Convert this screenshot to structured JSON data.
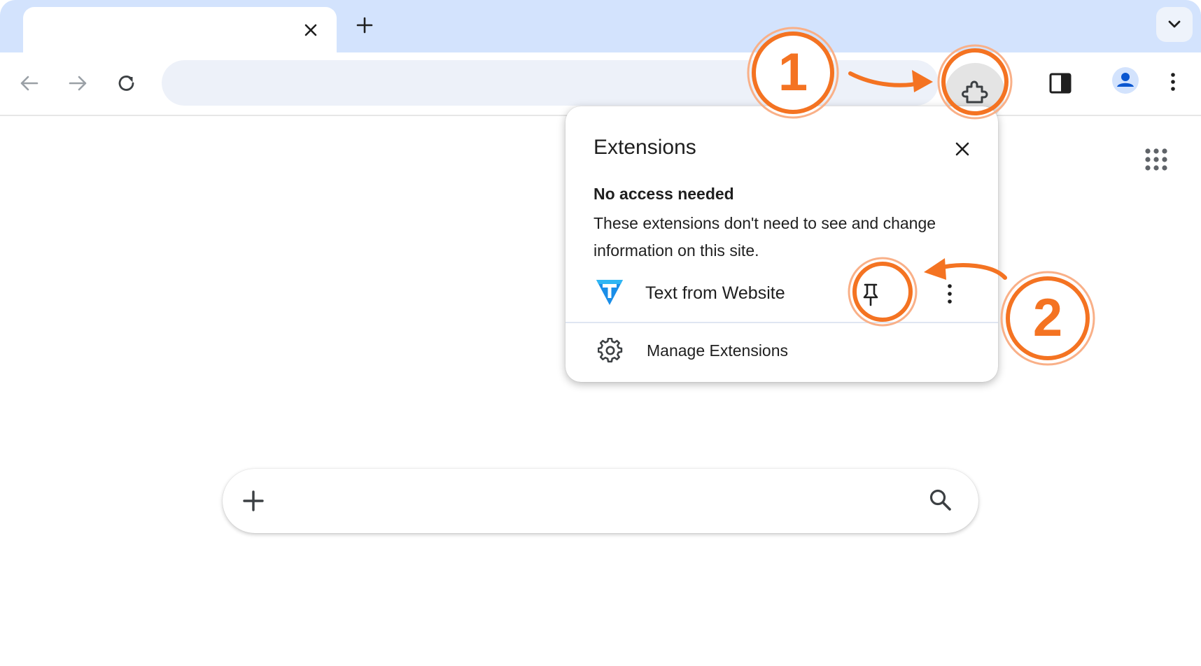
{
  "popup": {
    "title": "Extensions",
    "section_heading": "No access needed",
    "section_description": "These extensions don't need to see and change information on this site.",
    "extensions": [
      {
        "name": "Text from Website",
        "logo_letter": "T",
        "icon": "text-from-website-logo"
      }
    ],
    "manage_label": "Manage Extensions"
  },
  "annotations": {
    "step1": "1",
    "step2": "2"
  },
  "colors": {
    "accent": "#f47322",
    "tabstrip": "#d3e3fd",
    "omnibox": "#edf1f9",
    "logo_blue": "#1a8ee8"
  },
  "icons": {
    "toolbar": [
      "back-arrow-icon",
      "forward-arrow-icon",
      "reload-icon",
      "puzzle-icon",
      "side-panel-icon",
      "profile-icon",
      "kebab-menu-icon"
    ],
    "tabstrip": [
      "close-icon",
      "plus-icon",
      "chevron-down-icon"
    ],
    "page": [
      "apps-grid-icon",
      "plus-icon",
      "search-icon"
    ],
    "popup": [
      "close-icon",
      "pin-icon",
      "more-vert-icon",
      "gear-icon"
    ]
  }
}
